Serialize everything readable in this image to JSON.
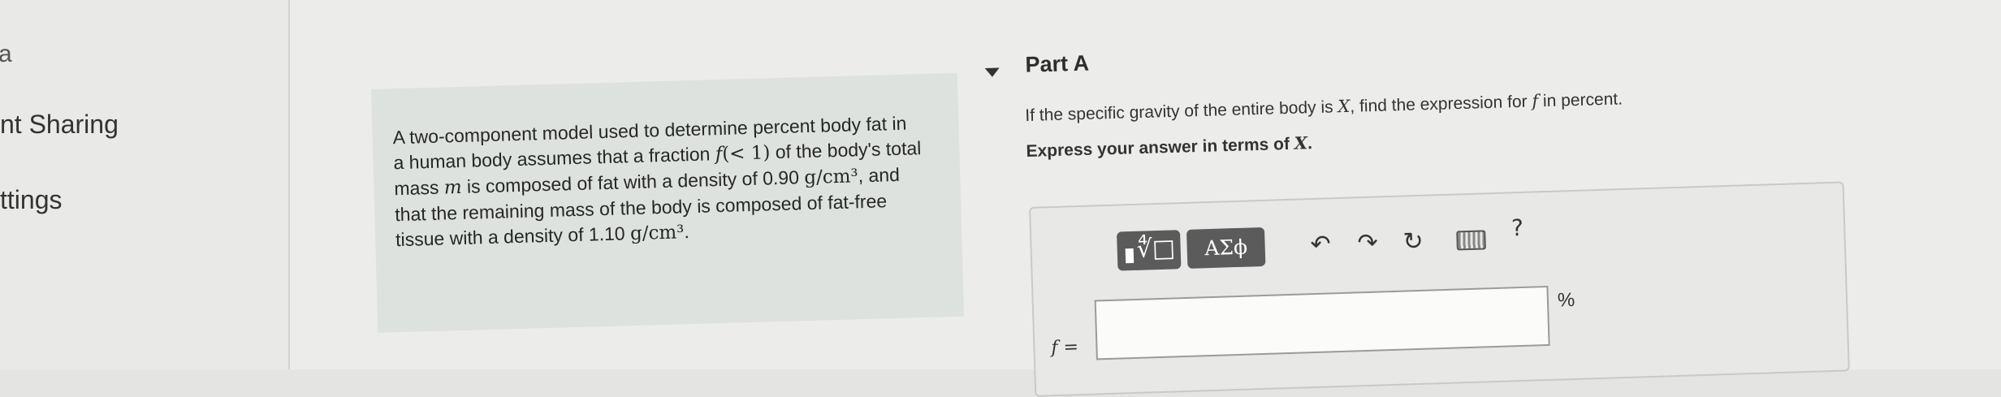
{
  "sidebar": {
    "partial": "a",
    "items": [
      {
        "label": "nt Sharing"
      },
      {
        "label": "ttings"
      }
    ]
  },
  "problem": {
    "s1": "A two-component model used to determine percent body fat in a human body assumes that a fraction ",
    "f": "f",
    "lt1": "(< 1)",
    "s2": " of the body's total mass ",
    "m": "m",
    "s3": " is composed of fat with a density of 0.90 ",
    "unit1": "g/cm³",
    "s4": ", and that the remaining mass of the body is composed of fat-free tissue with a density of 1.10 ",
    "unit2": "g/cm³",
    "s5": "."
  },
  "part": {
    "title": "Part A",
    "question_pre": "If the specific gravity of the entire body is ",
    "question_X": "X",
    "question_mid": ", find the expression for ",
    "question_f": "f",
    "question_post": " in percent.",
    "express_pre": "Express your answer in terms of ",
    "express_X": "X",
    "express_post": "."
  },
  "toolbar": {
    "templates_icon": "∜□",
    "greek_label": "ΑΣϕ",
    "undo_icon": "↶",
    "redo_icon": "↷",
    "reset_icon": "↻",
    "help_icon": "?"
  },
  "answer": {
    "label": "f =",
    "value": "",
    "unit": "%"
  },
  "colors": {
    "toolbar_button": "#5b5b5b",
    "problem_background": "#dee2df",
    "input_background": "#fbfbfa"
  }
}
